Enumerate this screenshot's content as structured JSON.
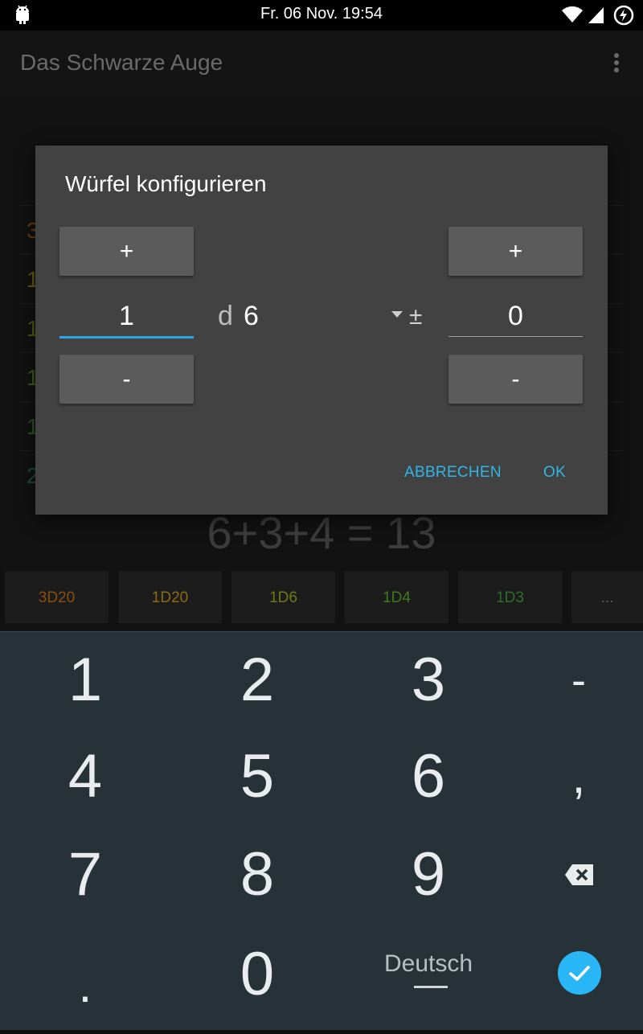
{
  "status_bar": {
    "time": "Fr. 06 Nov. 19:54"
  },
  "app_bar": {
    "title": "Das Schwarze Auge"
  },
  "background": {
    "history_rows": [
      {
        "text": "3",
        "color": "#6a3d12"
      },
      {
        "text": "1",
        "color": "#6b5a12"
      },
      {
        "text": "1",
        "color": "#4f5a14"
      },
      {
        "text": "1",
        "color": "#3e5a1c"
      },
      {
        "text": "1",
        "color": "#2e5224"
      },
      {
        "text": "2",
        "color": "#1f4a3a"
      }
    ],
    "result": "6+3+4 = 13",
    "dice_buttons": [
      {
        "label": "3D20",
        "color": "#8a4e10"
      },
      {
        "label": "1D20",
        "color": "#8a6c10"
      },
      {
        "label": "1D6",
        "color": "#6f7a14"
      },
      {
        "label": "1D4",
        "color": "#3f7a1c"
      },
      {
        "label": "1D3",
        "color": "#2d6e2a"
      },
      {
        "label": "...",
        "color": "#5a5a5a"
      }
    ]
  },
  "dialog": {
    "title": "Würfel konfigurieren",
    "plus_label": "+",
    "minus_label": "-",
    "count_value": "1",
    "d_label": "d",
    "sides_value": "6",
    "plusminus": "±",
    "modifier_value": "0",
    "cancel_label": "ABBRECHEN",
    "ok_label": "OK"
  },
  "keyboard": {
    "keys": [
      "1",
      "2",
      "3",
      "-",
      "4",
      "5",
      "6",
      ",",
      "7",
      "8",
      "9",
      ".",
      "0"
    ],
    "language": "Deutsch"
  },
  "colors": {
    "accent": "#33b5e5",
    "focus_underline": "#29a8e0",
    "dialog_bg": "#424242",
    "keyboard_bg": "#263238"
  }
}
